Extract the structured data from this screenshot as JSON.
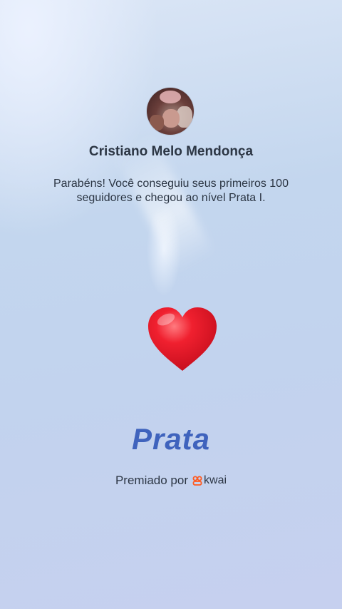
{
  "profile": {
    "name": "Cristiano Melo Mendonça",
    "avatar_icon": "profile-photo"
  },
  "achievement": {
    "message": "Parabéns! Você conseguiu seus primeiros 100 seguidores e chegou ao nível Prata I.",
    "badge_icon": "heart-icon",
    "level_label": "Prata"
  },
  "footer": {
    "awarded_by": "Premiado por",
    "brand_name": "kwai",
    "brand_icon": "kwai-logo-icon",
    "brand_color": "#ff5a1f"
  },
  "colors": {
    "heart": "#e8182a",
    "level_text": "#3f63bd",
    "text": "#2c3644"
  }
}
